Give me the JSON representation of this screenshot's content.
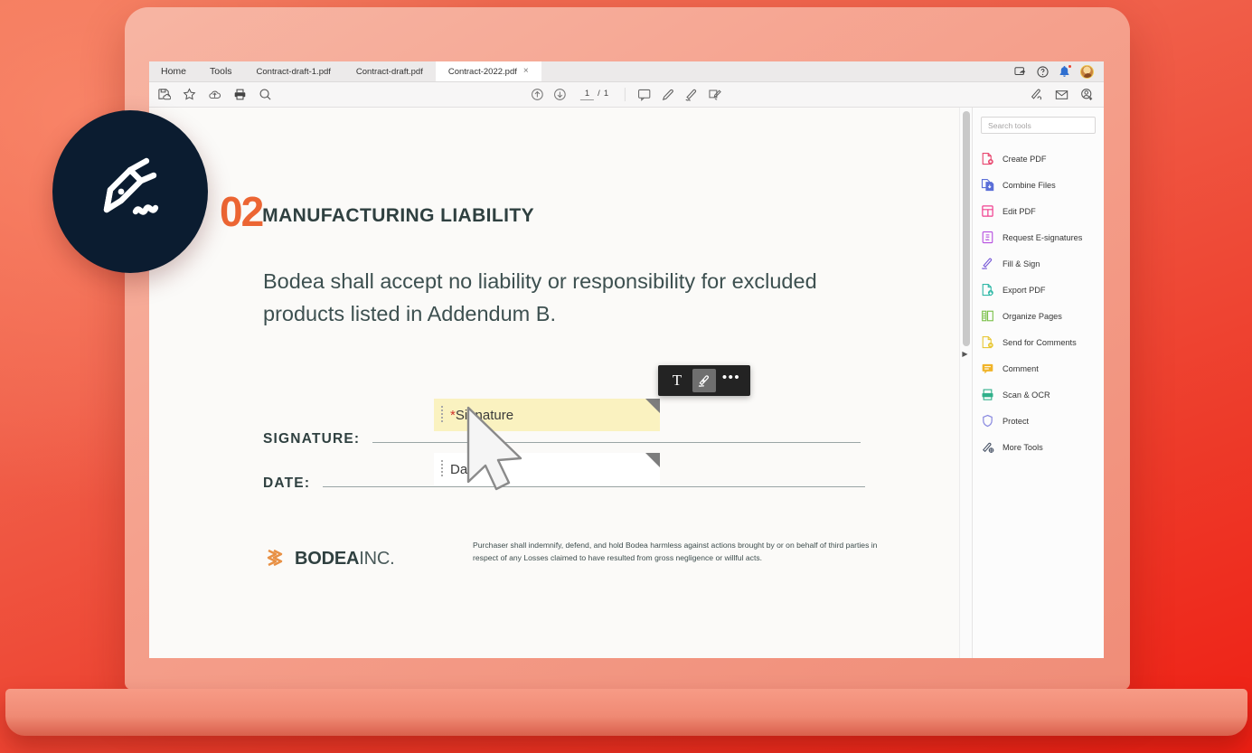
{
  "window": {
    "menus": [
      {
        "label": "Home",
        "name": "menu-home"
      },
      {
        "label": "Tools",
        "name": "menu-tools"
      }
    ],
    "tabs": [
      {
        "label": "Contract-draft-1.pdf",
        "active": false
      },
      {
        "label": "Contract-draft.pdf",
        "active": false
      },
      {
        "label": "Contract-2022.pdf",
        "active": true,
        "close": "×"
      }
    ],
    "account_icons": [
      "share-icon",
      "help-icon",
      "notification-bell-icon",
      "user-avatar"
    ]
  },
  "toolbar": {
    "left_icons": [
      "save-to-cloud-icon",
      "star-bookmark-icon",
      "upload-cloud-icon",
      "print-icon",
      "zoom-search-icon"
    ],
    "page_current": "1",
    "page_separator": "/",
    "page_total": "1",
    "center_icons": [
      "previous-page-icon",
      "next-page-icon",
      "comment-icon",
      "highlight-pen-icon",
      "sign-icon",
      "fill-and-sign-icon"
    ],
    "right_icons": [
      "request-signature-icon",
      "email-icon",
      "add-person-icon"
    ]
  },
  "document": {
    "section_number": "02",
    "section_title": "MANUFACTURING LIABILITY",
    "body": "Bodea shall accept no liability or responsibility for excluded products listed in Addendum B.",
    "signature_label": "SIGNATURE:",
    "date_label": "DATE:",
    "fields": {
      "signature": {
        "required_mark": "*",
        "placeholder": "Signature"
      },
      "date": {
        "placeholder": "Date"
      }
    },
    "brand": {
      "bold": "BODEA",
      "light": "INC."
    },
    "legal": "Purchaser shall indemnify, defend, and hold Bodea harmless against actions brought by or on behalf of third parties in respect of any Losses claimed to have resulted from gross negligence or willful acts."
  },
  "float_toolbar": {
    "text_label": "T",
    "more_label": "•••",
    "items": [
      "add-text-icon",
      "add-signature-icon",
      "more-options-icon"
    ],
    "active": "add-signature-icon"
  },
  "tools_panel": {
    "search_placeholder": "Search tools",
    "items": [
      {
        "label": "Create PDF",
        "icon": "create-pdf-icon",
        "color": "#e8476f"
      },
      {
        "label": "Combine Files",
        "icon": "combine-files-icon",
        "color": "#5b6fd8"
      },
      {
        "label": "Edit PDF",
        "icon": "edit-pdf-icon",
        "color": "#f0408f"
      },
      {
        "label": "Request E-signatures",
        "icon": "request-esignatures-icon",
        "color": "#b650e0"
      },
      {
        "label": "Fill & Sign",
        "icon": "fill-and-sign-icon",
        "color": "#7a5cd8"
      },
      {
        "label": "Export PDF",
        "icon": "export-pdf-icon",
        "color": "#2fb8a6"
      },
      {
        "label": "Organize Pages",
        "icon": "organize-pages-icon",
        "color": "#7bc04a"
      },
      {
        "label": "Send for Comments",
        "icon": "send-for-comments-icon",
        "color": "#e8c838"
      },
      {
        "label": "Comment",
        "icon": "comment-icon",
        "color": "#f0b429"
      },
      {
        "label": "Scan & OCR",
        "icon": "scan-and-ocr-icon",
        "color": "#30b08a"
      },
      {
        "label": "Protect",
        "icon": "protect-shield-icon",
        "color": "#8a8ae0"
      },
      {
        "label": "More Tools",
        "icon": "more-tools-icon",
        "color": "#4a5568"
      }
    ]
  },
  "badge": {
    "icon": "esignature-pen-nib-icon"
  },
  "colors": {
    "accent_orange": "#ec6533",
    "heading_teal": "#2f4040",
    "badge_navy": "#0b1c30",
    "highlight_yellow": "#faf2c0",
    "required_red": "#d0342c",
    "background_red": "#ed3b2a"
  }
}
